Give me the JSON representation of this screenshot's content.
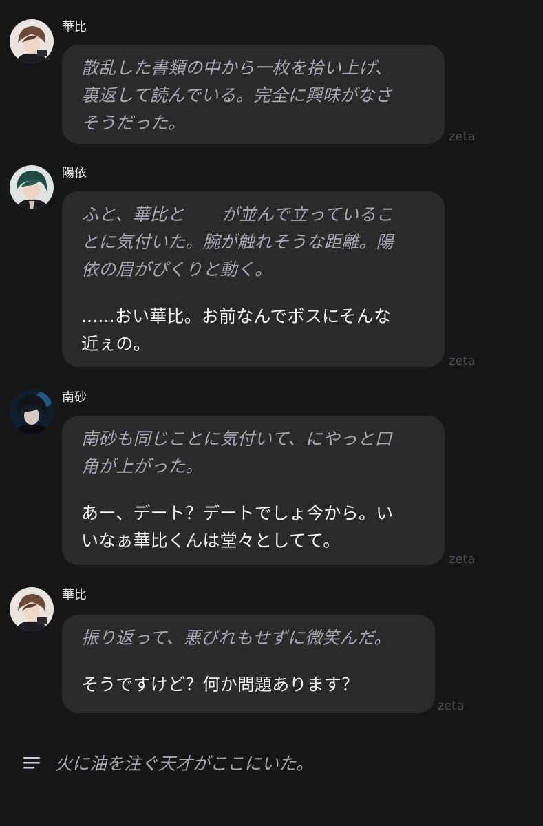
{
  "messages": [
    {
      "name": "華比",
      "avatar_icon": "character-avatar-brown-hair",
      "lines": [
        {
          "text": "散乱した書類の中から一枚を拾い上げ、",
          "style": "italic"
        },
        {
          "text": "裏返して読んでいる。完全に興味がなさ",
          "style": "italic"
        },
        {
          "text": "そうだった。",
          "style": "italic"
        }
      ],
      "source": "zeta"
    },
    {
      "name": "陽依",
      "avatar_icon": "character-avatar-green-hair",
      "lines": [
        {
          "text_before": "ふと、華比と",
          "text_after": "が並んで立っているこ",
          "style": "italic"
        },
        {
          "text": "とに気付いた。腕が触れそうな距離。陽",
          "style": "italic"
        },
        {
          "text": "依の眉がぴくりと動く。",
          "style": "italic"
        },
        {
          "text": "......おい華比。お前なんでボスにそんな",
          "style": "plain"
        },
        {
          "text": "近ぇの。",
          "style": "plain"
        }
      ],
      "source": "zeta"
    },
    {
      "name": "南砂",
      "avatar_icon": "character-avatar-dark-hair-blue",
      "lines": [
        {
          "text": "南砂も同じことに気付いて、にやっと口",
          "style": "italic"
        },
        {
          "text": "角が上がった。",
          "style": "italic"
        },
        {
          "text": "あー、デート？デートでしょ今から。い",
          "style": "plain"
        },
        {
          "text": "いなぁ華比くんは堂々としてて。",
          "style": "plain"
        }
      ],
      "source": "zeta"
    },
    {
      "name": "華比",
      "avatar_icon": "character-avatar-brown-hair",
      "lines": [
        {
          "text": "振り返って、悪びれもせずに微笑んだ。",
          "style": "italic"
        },
        {
          "text": "そうですけど？何か問題あります？",
          "style": "plain"
        }
      ],
      "source": "zeta"
    }
  ],
  "footer": {
    "icon": "menu-lines-icon",
    "text": "火に油を注ぐ天才がここにいた。"
  },
  "colors": {
    "background": "#161618",
    "bubble": "#2a2a2d",
    "italic_text": "#a9a9ad",
    "plain_text": "#f2f2f4",
    "watermark": "#4a4a4e"
  }
}
